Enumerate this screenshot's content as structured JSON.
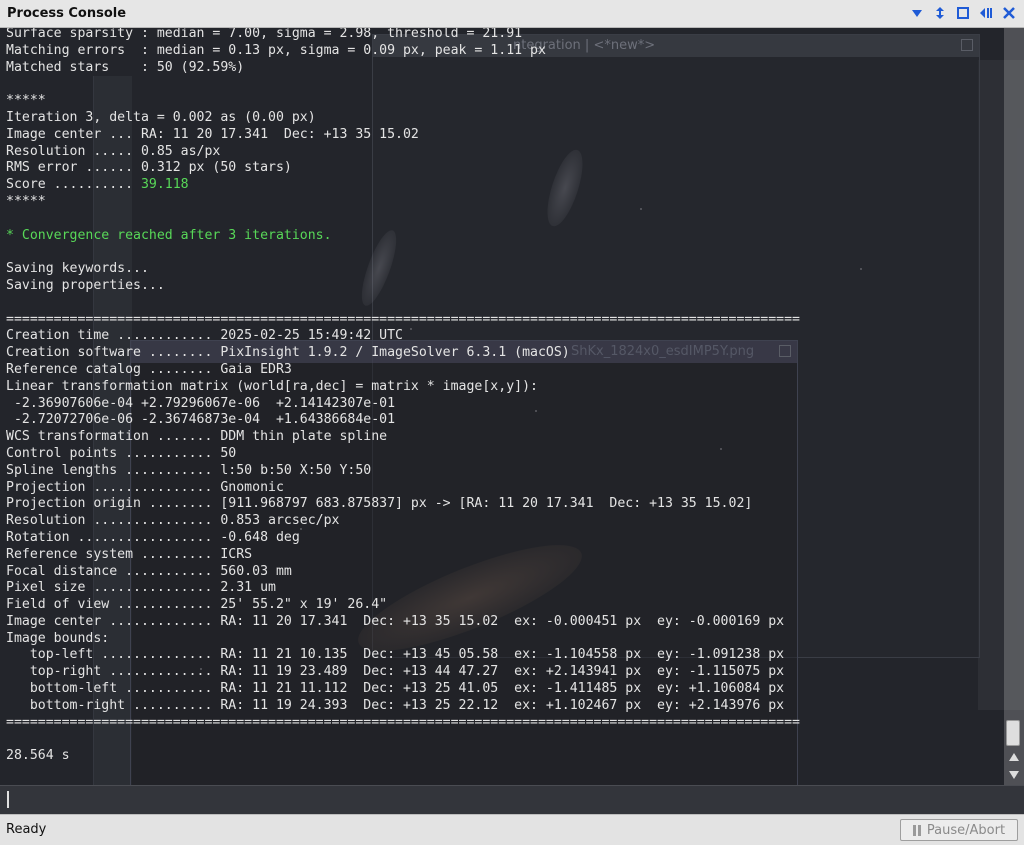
{
  "window": {
    "title": "Process Console",
    "controls": [
      "collapse-icon",
      "resize-icon",
      "maximize-icon",
      "dock-icon",
      "close-icon"
    ]
  },
  "background": {
    "window1_title": "ntegration | <*new*>",
    "window2_title": "ShKx_1824x0_esdIMP5Y.png"
  },
  "log": {
    "lines": [
      {
        "text": "Surface sparsity : median = 7.00, sigma = 2.98, threshold = 21.91"
      },
      {
        "text": "Matching errors  : median = 0.13 px, sigma = 0.09 px, peak = 1.11 px"
      },
      {
        "text": "Matched stars    : 50 (92.59%)"
      },
      {
        "text": ""
      },
      {
        "text": "*****"
      },
      {
        "text": "Iteration 3, delta = 0.002 as (0.00 px)"
      },
      {
        "text": "Image center ... RA: 11 20 17.341  Dec: +13 35 15.02"
      },
      {
        "text": "Resolution ..... 0.85 as/px"
      },
      {
        "text": "RMS error ...... 0.312 px (50 stars)"
      },
      {
        "text": "Score .......... ",
        "highlight": "39.118"
      },
      {
        "text": "*****"
      },
      {
        "text": ""
      },
      {
        "text": "* Convergence reached after 3 iterations.",
        "green": true
      },
      {
        "text": ""
      },
      {
        "text": "Saving keywords..."
      },
      {
        "text": "Saving properties..."
      },
      {
        "text": ""
      },
      {
        "text": "===================================================================================================="
      },
      {
        "text": "Creation time ............ 2025-02-25 15:49:42 UTC"
      },
      {
        "text": "Creation software ........ PixInsight 1.9.2 / ImageSolver 6.3.1 (macOS)"
      },
      {
        "text": "Reference catalog ........ Gaia EDR3"
      },
      {
        "text": "Linear transformation matrix (world[ra,dec] = matrix * image[x,y]):"
      },
      {
        "text": " -2.36907606e-04 +2.79296067e-06  +2.14142307e-01"
      },
      {
        "text": " -2.72072706e-06 -2.36746873e-04  +1.64386684e-01"
      },
      {
        "text": "WCS transformation ....... DDM thin plate spline"
      },
      {
        "text": "Control points ........... 50"
      },
      {
        "text": "Spline lengths ........... l:50 b:50 X:50 Y:50"
      },
      {
        "text": "Projection ............... Gnomonic"
      },
      {
        "text": "Projection origin ........ [911.968797 683.875837] px -> [RA: 11 20 17.341  Dec: +13 35 15.02]"
      },
      {
        "text": "Resolution ............... 0.853 arcsec/px"
      },
      {
        "text": "Rotation ................. -0.648 deg"
      },
      {
        "text": "Reference system ......... ICRS"
      },
      {
        "text": "Focal distance ........... 560.03 mm"
      },
      {
        "text": "Pixel size ............... 2.31 um"
      },
      {
        "text": "Field of view ............ 25' 55.2\" x 19' 26.4\""
      },
      {
        "text": "Image center ............. RA: 11 20 17.341  Dec: +13 35 15.02  ex: -0.000451 px  ey: -0.000169 px"
      },
      {
        "text": "Image bounds:"
      },
      {
        "text": "   top-left .............. RA: 11 21 10.135  Dec: +13 45 05.58  ex: -1.104558 px  ey: -1.091238 px"
      },
      {
        "text": "   top-right ............. RA: 11 19 23.489  Dec: +13 44 47.27  ex: +2.143941 px  ey: -1.115075 px"
      },
      {
        "text": "   bottom-left ........... RA: 11 21 11.112  Dec: +13 25 41.05  ex: -1.411485 px  ey: +1.106084 px"
      },
      {
        "text": "   bottom-right .......... RA: 11 19 24.393  Dec: +13 25 22.12  ex: +1.102467 px  ey: +2.143976 px"
      },
      {
        "text": "===================================================================================================="
      },
      {
        "text": ""
      },
      {
        "text": "28.564 s"
      }
    ]
  },
  "command": {
    "value": ""
  },
  "status": {
    "text": "Ready",
    "pause_label": "Pause/Abort"
  },
  "colors": {
    "console_bg": "#23252b",
    "text": "#e4e4e4",
    "success": "#58d858"
  }
}
